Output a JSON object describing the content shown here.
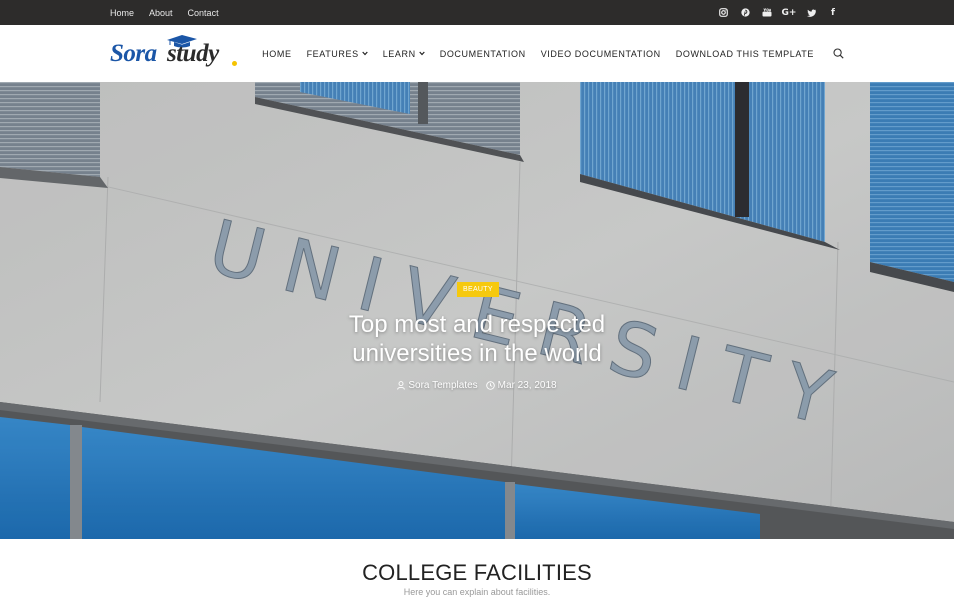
{
  "topbar": {
    "links": [
      "Home",
      "About",
      "Contact"
    ],
    "social": [
      {
        "icon": "instagram-icon"
      },
      {
        "icon": "pinterest-icon"
      },
      {
        "icon": "youtube-icon"
      },
      {
        "icon": "google-plus-icon",
        "text": "G+"
      },
      {
        "icon": "twitter-icon"
      },
      {
        "icon": "facebook-icon",
        "text": "f"
      }
    ]
  },
  "logo": {
    "part1": "Sora",
    "part2": "study"
  },
  "nav": {
    "items": [
      {
        "label": "HOME"
      },
      {
        "label": "FEATURES"
      },
      {
        "label": "LEARN"
      },
      {
        "label": "DOCUMENTATION"
      },
      {
        "label": "VIDEO DOCUMENTATION"
      },
      {
        "label": "DOWNLOAD THIS TEMPLATE"
      }
    ]
  },
  "hero": {
    "sign_text": "UNIVERSITY",
    "badge": "BEAUTY",
    "title_line1": "Top most and respected",
    "title_line2": "universities in the world",
    "author": "Sora Templates",
    "date": "Mar 23, 2018"
  },
  "section": {
    "title": "COLLEGE FACILITIES",
    "subtitle": "Here you can explain about facilities."
  },
  "colors": {
    "topbar_bg": "#2d2c2b",
    "logo_blue": "#1b56a7",
    "badge_yellow": "#f6c90e",
    "window_blue": "#2d80c6"
  }
}
